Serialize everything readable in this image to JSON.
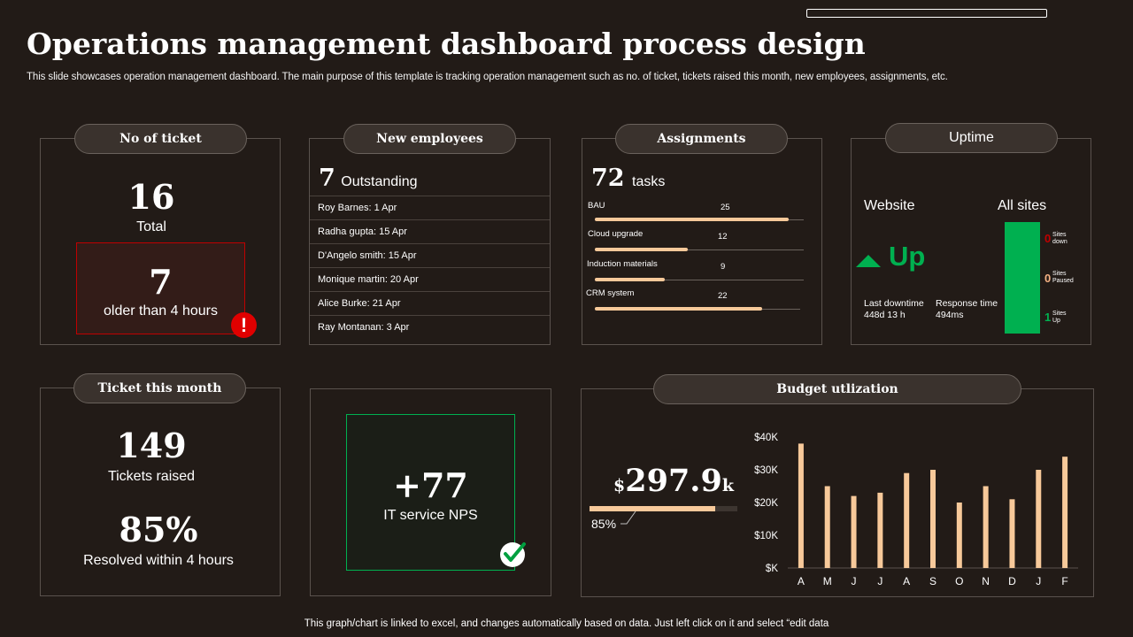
{
  "title": "Operations management dashboard process design",
  "subtitle": "This slide showcases operation management dashboard. The main purpose of this template is tracking operation management such as no. of ticket, tickets raised this month, new employees, assignments, etc.",
  "footer": "This graph/chart is linked to excel,  and changes automatically based on data. Just left click on it and select “edit data",
  "tickets": {
    "header": "No of ticket",
    "total_value": "16",
    "total_label": "Total",
    "older_value": "7",
    "older_label": "older than 4 hours",
    "alert_icon": "exclamation-alert-icon",
    "alert_glyph": "!"
  },
  "employees": {
    "header": "New employees",
    "count": "7",
    "count_label": "Outstanding",
    "rows": [
      "Roy Barnes: 1 Apr",
      "Radha gupta: 15 Apr",
      "D'Angelo smith: 15 Apr",
      "Monique martin: 20 Apr",
      "Alice Burke: 21 Apr",
      "Ray Montanan: 3 Apr"
    ]
  },
  "assignments": {
    "header": "Assignments",
    "count": "72",
    "count_label": "tasks",
    "tasks": [
      {
        "name": "BAU",
        "value": 25
      },
      {
        "name": "Cloud upgrade",
        "value": 12
      },
      {
        "name": "Induction materials",
        "value": 9
      },
      {
        "name": "CRM system",
        "value": 22
      }
    ]
  },
  "uptime": {
    "header": "Uptime",
    "website_label": "Website",
    "all_sites_label": "All sites",
    "status": "Up",
    "status_icon": "triangle-up-icon",
    "last_downtime_label": "Last downtime",
    "last_downtime_value": "448d 13 h",
    "response_time_label": "Response time",
    "response_time_value": "494ms",
    "sites": [
      {
        "count": "0",
        "label_line1": "Sites",
        "label_line2": "down",
        "color": "#c00000"
      },
      {
        "count": "0",
        "label_line1": "Sites",
        "label_line2": "Paused",
        "color": "#f4b183"
      },
      {
        "count": "1",
        "label_line1": "Sites",
        "label_line2": "Up",
        "color": "#00b050"
      }
    ],
    "up_color": "#00b050"
  },
  "ticket_month": {
    "header": "Ticket this month",
    "raised_value": "149",
    "raised_label": "Tickets raised",
    "resolved_value": "85%",
    "resolved_label": "Resolved within 4 hours"
  },
  "nps": {
    "value": "+77",
    "label": "IT service NPS",
    "check_icon": "checkmark-icon"
  },
  "budget": {
    "header": "Budget utlization",
    "currency": "$",
    "amount": "297.9",
    "suffix": "k",
    "progress_percent": 85,
    "progress_label": "85%"
  },
  "colors": {
    "background": "#221b17",
    "accent_peach": "#f7c99a",
    "alert_red": "#e00000",
    "nps_green": "#00b050"
  },
  "chart_data": {
    "type": "bar",
    "categories": [
      "A",
      "M",
      "J",
      "J",
      "A",
      "S",
      "O",
      "N",
      "D",
      "J",
      "F"
    ],
    "values": [
      38000,
      25000,
      22000,
      23000,
      29000,
      30000,
      20000,
      25000,
      21000,
      30000,
      34000
    ],
    "ylim": [
      0,
      40000
    ],
    "yticks": [
      "$K",
      "$10K",
      "$20K",
      "$30K",
      "$40K"
    ],
    "title": "",
    "xlabel": "",
    "ylabel": "",
    "grid": false
  }
}
